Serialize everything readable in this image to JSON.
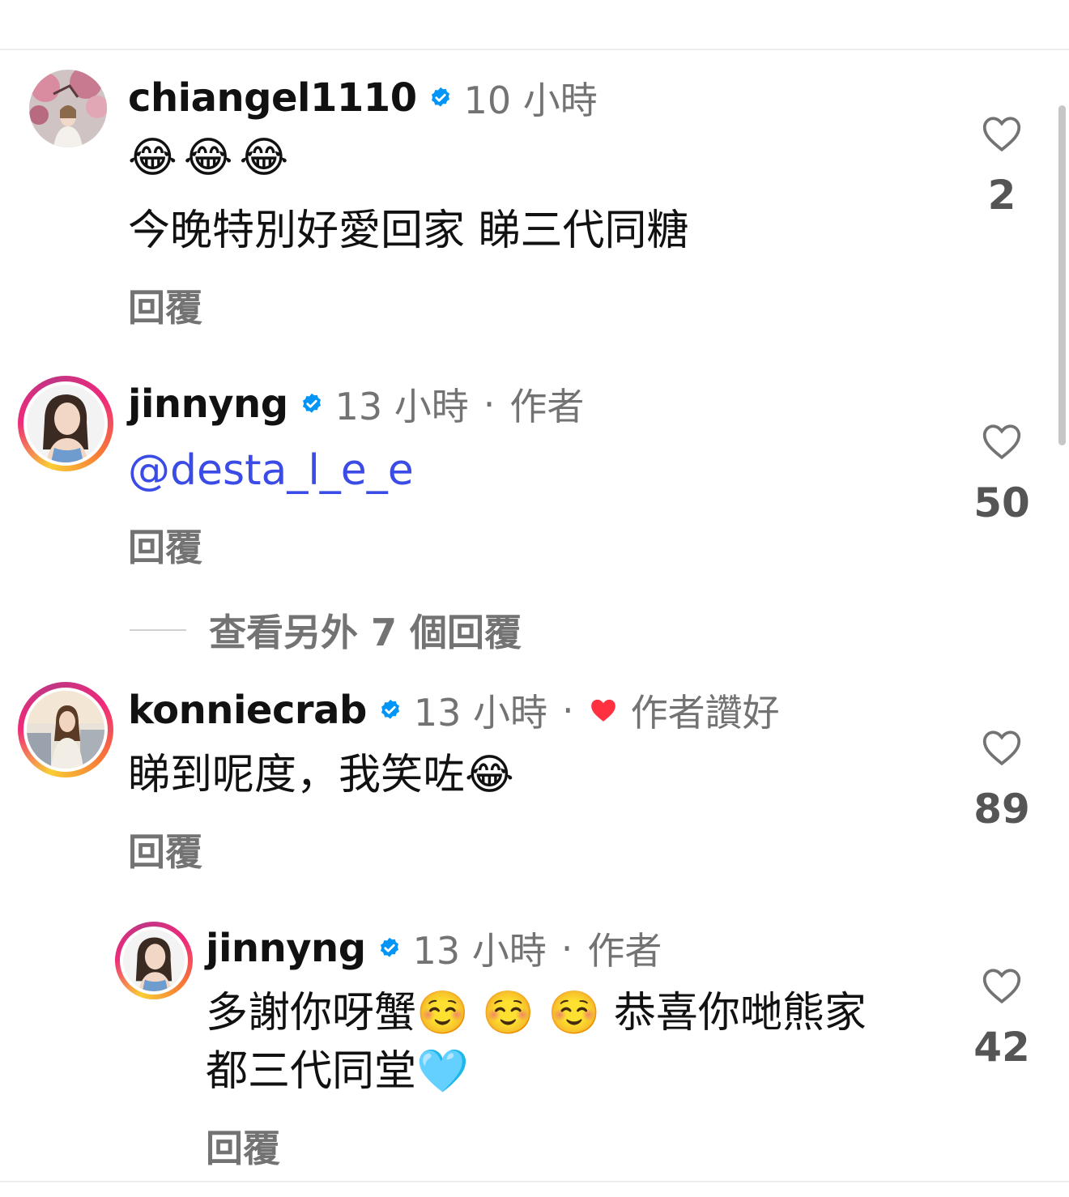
{
  "comments": [
    {
      "username": "chiangel1110",
      "time": "10 小時",
      "emojis": [
        "😂",
        "😂",
        "😂"
      ],
      "text": "今晚特別好愛回家 睇三代同糖",
      "reply_label": "回覆",
      "likes": "2"
    },
    {
      "username": "jinnyng",
      "time": "13 小時",
      "separator": "·",
      "badge": "作者",
      "mention": "@desta_l_e_e",
      "reply_label": "回覆",
      "likes": "50"
    },
    {
      "username": "konniecrab",
      "time": "13 小時",
      "separator": "·",
      "author_liked": "作者讚好",
      "text": "睇到呢度，我笑咗",
      "text_emoji": "😂",
      "reply_label": "回覆",
      "likes": "89"
    },
    {
      "username": "jinnyng",
      "time": "13 小時",
      "separator": "·",
      "badge": "作者",
      "line1_a": "多謝你呀蟹",
      "line1_emojis": [
        "☺️",
        "☺️",
        "☺️"
      ],
      "line1_b": "恭喜你哋熊家",
      "line2": "都三代同堂",
      "line2_emoji": "🩵",
      "reply_label": "回覆",
      "likes": "42"
    }
  ],
  "view_more_replies": "查看另外 7 個回覆",
  "colors": {
    "verified": "#0095f6",
    "mention": "#3b4be6",
    "meta": "#737373",
    "author_like_heart": "#ff3040"
  },
  "icons": {
    "like": "heart-outline-icon",
    "verified": "verified-badge-icon",
    "author_like": "heart-filled-icon"
  }
}
